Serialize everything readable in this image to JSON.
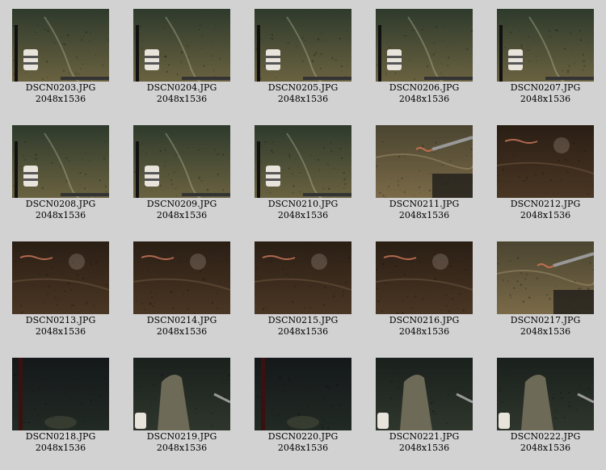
{
  "thumbnails": [
    {
      "file": "DSCN0203.JPG",
      "dims": "2048x1536",
      "scene": "sand-green",
      "icon": "seafloor-photo-icon"
    },
    {
      "file": "DSCN0204.JPG",
      "dims": "2048x1536",
      "scene": "sand-green",
      "icon": "seafloor-photo-icon"
    },
    {
      "file": "DSCN0205.JPG",
      "dims": "2048x1536",
      "scene": "sand-green",
      "icon": "seafloor-photo-icon"
    },
    {
      "file": "DSCN0206.JPG",
      "dims": "2048x1536",
      "scene": "sand-green",
      "icon": "seafloor-photo-icon"
    },
    {
      "file": "DSCN0207.JPG",
      "dims": "2048x1536",
      "scene": "sand-green",
      "icon": "seafloor-photo-icon"
    },
    {
      "file": "DSCN0208.JPG",
      "dims": "2048x1536",
      "scene": "sand-green",
      "icon": "seafloor-photo-icon"
    },
    {
      "file": "DSCN0209.JPG",
      "dims": "2048x1536",
      "scene": "sand-green",
      "icon": "seafloor-photo-icon"
    },
    {
      "file": "DSCN0210.JPG",
      "dims": "2048x1536",
      "scene": "sand-green",
      "icon": "seafloor-photo-icon"
    },
    {
      "file": "DSCN0211.JPG",
      "dims": "2048x1536",
      "scene": "sand-arm",
      "icon": "seafloor-photo-icon"
    },
    {
      "file": "DSCN0212.JPG",
      "dims": "2048x1536",
      "scene": "brown-dark",
      "icon": "seafloor-photo-icon"
    },
    {
      "file": "DSCN0213.JPG",
      "dims": "2048x1536",
      "scene": "brown-dark",
      "icon": "seafloor-photo-icon"
    },
    {
      "file": "DSCN0214.JPG",
      "dims": "2048x1536",
      "scene": "brown-dark",
      "icon": "seafloor-photo-icon"
    },
    {
      "file": "DSCN0215.JPG",
      "dims": "2048x1536",
      "scene": "brown-dark",
      "icon": "seafloor-photo-icon"
    },
    {
      "file": "DSCN0216.JPG",
      "dims": "2048x1536",
      "scene": "brown-dark",
      "icon": "seafloor-photo-icon"
    },
    {
      "file": "DSCN0217.JPG",
      "dims": "2048x1536",
      "scene": "sand-arm",
      "icon": "seafloor-photo-icon"
    },
    {
      "file": "DSCN0218.JPG",
      "dims": "2048x1536",
      "scene": "deep-dark",
      "icon": "seafloor-photo-icon"
    },
    {
      "file": "DSCN0219.JPG",
      "dims": "2048x1536",
      "scene": "deep-rock",
      "icon": "seafloor-photo-icon"
    },
    {
      "file": "DSCN0220.JPG",
      "dims": "2048x1536",
      "scene": "deep-dark",
      "icon": "seafloor-photo-icon"
    },
    {
      "file": "DSCN0221.JPG",
      "dims": "2048x1536",
      "scene": "deep-rock",
      "icon": "seafloor-photo-icon"
    },
    {
      "file": "DSCN0222.JPG",
      "dims": "2048x1536",
      "scene": "deep-rock",
      "icon": "seafloor-photo-icon"
    }
  ],
  "colors": {
    "background": "#d2d2d2",
    "sand-green": "#5e5a3a",
    "sand-arm": "#6e5c3a",
    "brown-dark": "#3a2a1c",
    "deep-dark": "#1c2420",
    "deep-rock": "#2a3028",
    "bottle": "#e8e4dc"
  }
}
